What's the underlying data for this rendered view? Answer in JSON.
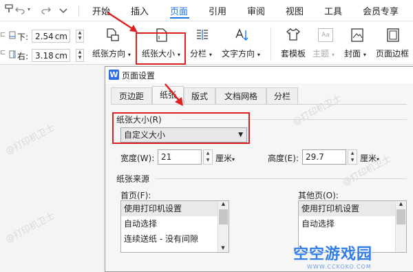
{
  "ribbon": {
    "tabs": [
      "开始",
      "插入",
      "页面",
      "引用",
      "审阅",
      "视图",
      "工具",
      "会员专享"
    ],
    "active_tab": "页面"
  },
  "toolbar": {
    "margin_bottom_label": "下:",
    "margin_bottom_value": "2.54",
    "margin_right_label": "右:",
    "margin_right_value": "3.18",
    "unit": "cm",
    "orientation_label": "纸张方向",
    "paper_size_label": "纸张大小",
    "columns_label": "分栏",
    "text_direction_label": "文字方向",
    "template_label": "套模板",
    "theme_label": "主题",
    "theme_glyph": "Aa",
    "cover_label": "封面",
    "page_border_label": "页面边框"
  },
  "watermark": "@打印机卫士",
  "dialog": {
    "logo": "W",
    "title": "页面设置",
    "tabs": [
      "页边距",
      "纸张",
      "版式",
      "文档网格",
      "分栏"
    ],
    "active_tab": "纸张",
    "paper_size_group": "纸张大小(R)",
    "paper_size_value": "自定义大小",
    "width_label": "宽度(W):",
    "width_value": "21",
    "height_label": "高度(E):",
    "height_value": "29.7",
    "unit_label": "厘米",
    "paper_source_group": "纸张来源",
    "first_page_label": "首页(F):",
    "other_pages_label": "其他页(O):",
    "first_page_options": [
      "使用打印机设置",
      "自动选择",
      "连续送纸 - 没有间隙"
    ],
    "other_pages_options": [
      "使用打印机设置",
      "自动选择"
    ]
  },
  "site_logo": {
    "name": "空空游戏园",
    "domain": "WWW.CCKOKO.COM"
  },
  "colors": {
    "accent": "#1a73e8",
    "highlight": "#e02020"
  }
}
